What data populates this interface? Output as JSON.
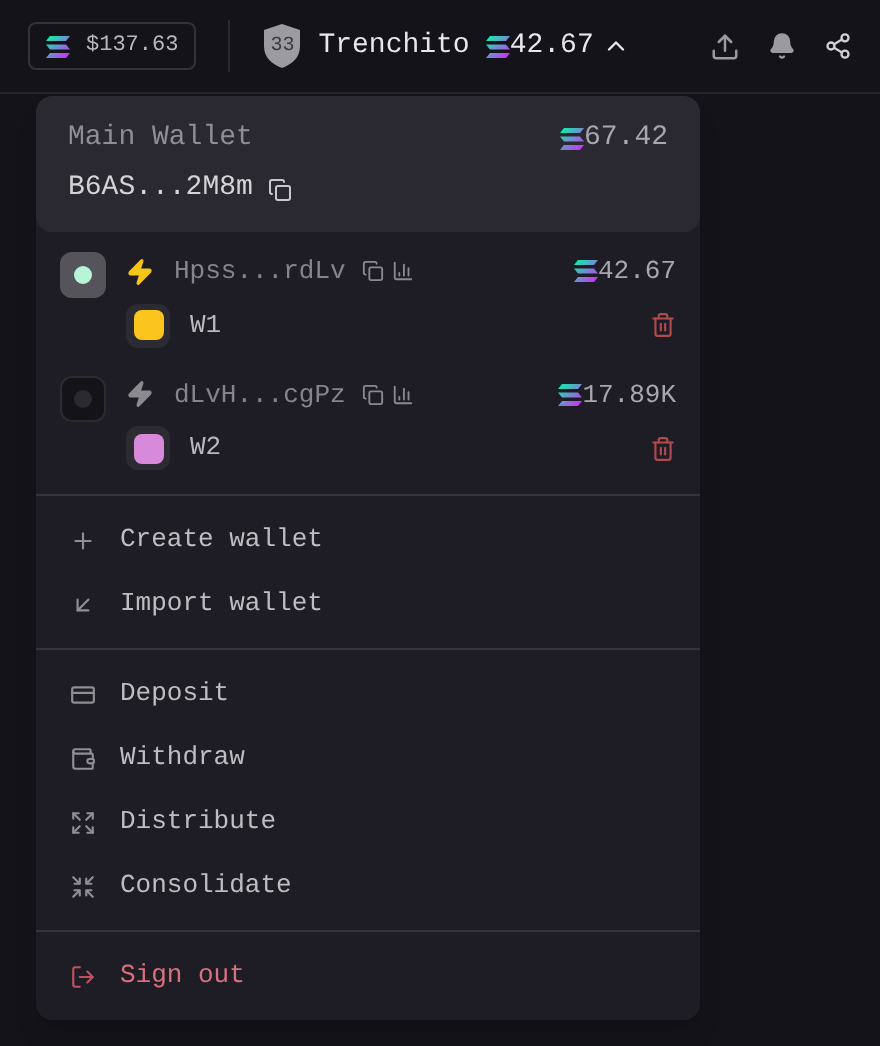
{
  "top_bar": {
    "balance": "$137.63",
    "level_badge": "33",
    "username": "Trenchito",
    "sol_balance": "42.67"
  },
  "menu": {
    "main_wallet": {
      "title": "Main Wallet",
      "address": "B6AS...2M8m",
      "balance": "67.42"
    },
    "wallets": [
      {
        "address": "Hpss...rdLv",
        "name": "W1",
        "balance": "42.67",
        "selected": true,
        "color": "#fbc51e"
      },
      {
        "address": "dLvH...cgPz",
        "name": "W2",
        "balance": "17.89K",
        "selected": false,
        "color": "#d68ad9"
      }
    ],
    "groups": [
      [
        {
          "label": "Create wallet",
          "kind": "normal"
        },
        {
          "label": "Import wallet",
          "kind": "normal"
        }
      ],
      [
        {
          "label": "Deposit",
          "kind": "normal"
        },
        {
          "label": "Withdraw",
          "kind": "normal"
        },
        {
          "label": "Distribute",
          "kind": "normal"
        },
        {
          "label": "Consolidate",
          "kind": "normal"
        }
      ],
      [
        {
          "label": "Sign out",
          "kind": "danger"
        }
      ]
    ]
  }
}
